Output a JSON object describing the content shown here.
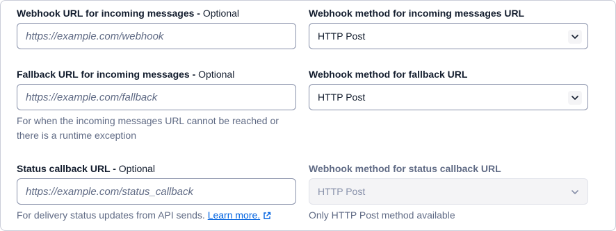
{
  "incoming": {
    "label": "Webhook URL for incoming messages - ",
    "optional": "Optional",
    "placeholder": "https://example.com/webhook",
    "method_label": "Webhook method for incoming messages URL",
    "method_value": "HTTP Post"
  },
  "fallback": {
    "label": "Fallback URL for incoming messages - ",
    "optional": "Optional",
    "placeholder": "https://example.com/fallback",
    "help_line1": "For when the incoming messages URL cannot be reached or",
    "help_line2": "there is a runtime exception",
    "method_label": "Webhook method for fallback URL",
    "method_value": "HTTP Post"
  },
  "status": {
    "label": "Status callback URL - ",
    "optional": "Optional",
    "placeholder": "https://example.com/status_callback",
    "help": "For delivery status updates from API sends. ",
    "learn_more": "Learn more.",
    "method_label": "Webhook method for status callback URL",
    "method_value": "HTTP Post",
    "method_help": "Only HTTP Post method available"
  },
  "icons": {
    "chevron": "chevron-down-icon",
    "external": "external-link-icon"
  },
  "colors": {
    "text": "#121c2d",
    "muted": "#606b85",
    "link": "#0263e0",
    "border": "#8891aa",
    "disabled_bg": "#f4f4f6"
  }
}
